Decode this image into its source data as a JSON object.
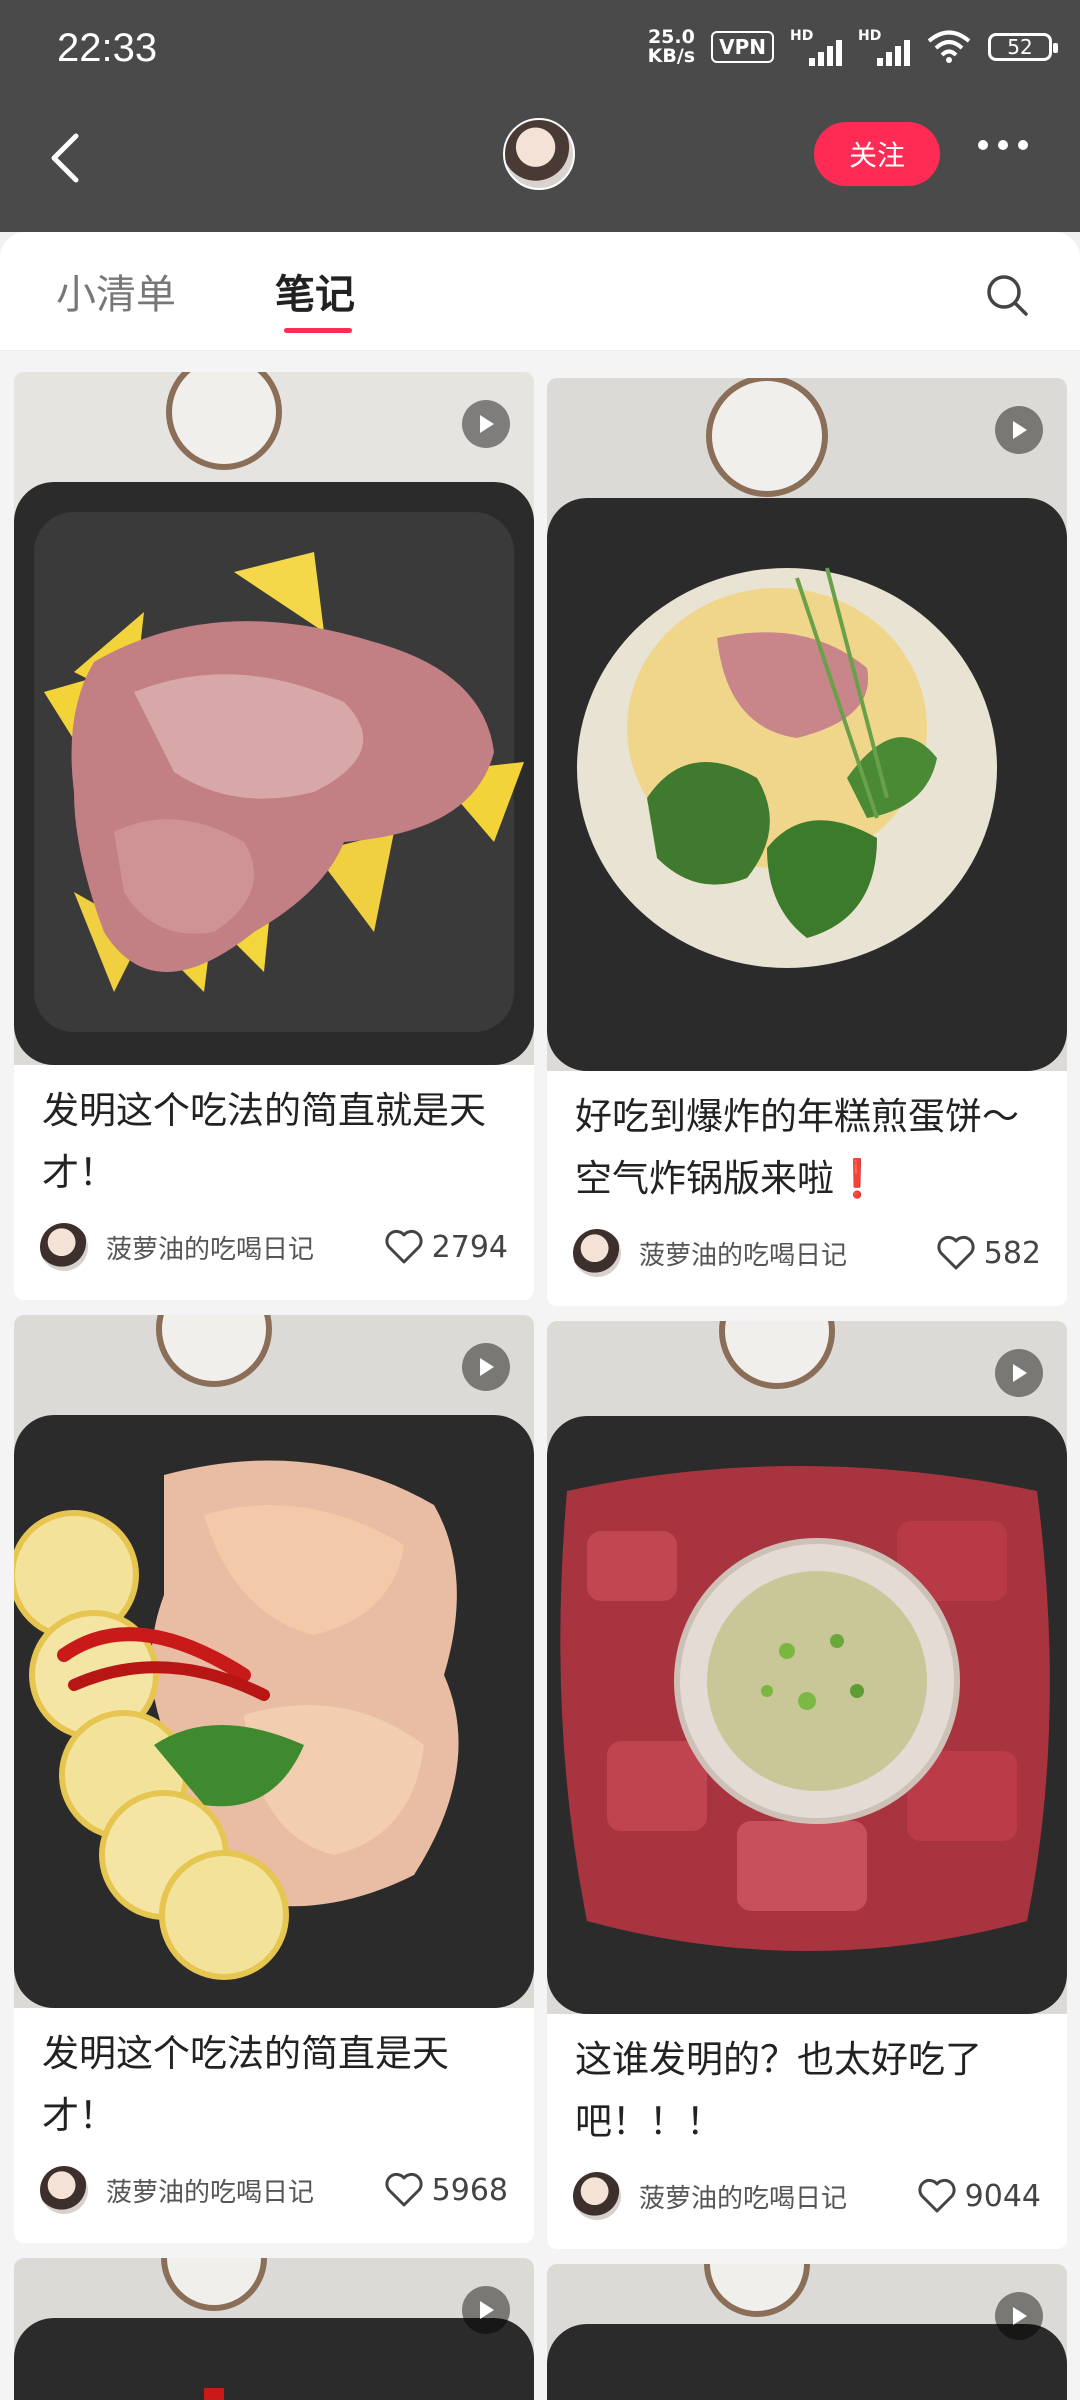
{
  "status_bar": {
    "time": "22:33",
    "net_speed_value": "25.0",
    "net_speed_unit": "KB/s",
    "vpn": "VPN",
    "hd": "HD",
    "battery": "52"
  },
  "header": {
    "follow_label": "关注"
  },
  "tabs": [
    {
      "label": "小清单"
    },
    {
      "label": "笔记"
    }
  ],
  "notes": [
    {
      "title": "发明这个吃法的简直就是天才！",
      "author": "菠萝油的吃喝日记",
      "likes": "2794"
    },
    {
      "title": "好吃到爆炸的年糕煎蛋饼～空气炸锅版来啦❗",
      "author": "菠萝油的吃喝日记",
      "likes": "582"
    },
    {
      "title": "发明这个吃法的简直是天才！",
      "author": "菠萝油的吃喝日记",
      "likes": "5968"
    },
    {
      "title": "这谁发明的？也太好吃了吧！！！",
      "author": "菠萝油的吃喝日记",
      "likes": "9044"
    }
  ]
}
